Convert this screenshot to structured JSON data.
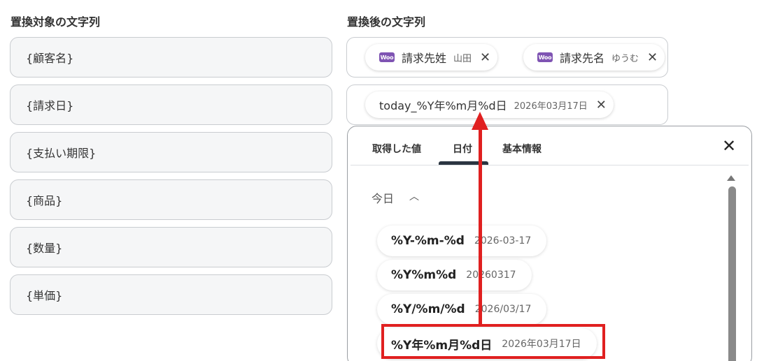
{
  "left": {
    "title": "置換対象の文字列",
    "fields": [
      "{顧客名}",
      "{請求日}",
      "{支払い期限}",
      "{商品}",
      "{数量}",
      "{単価}"
    ]
  },
  "right": {
    "title": "置換後の文字列",
    "row1_chips": [
      {
        "icon": "woo",
        "name": "請求先姓",
        "value": "山田"
      },
      {
        "icon": "woo",
        "name": "請求先名",
        "value": "ゆうむ"
      }
    ],
    "row2_chip": {
      "name": "today_%Y年%m月%d日",
      "value": "2026年03月17日"
    }
  },
  "panel": {
    "tabs": [
      "取得した値",
      "日付",
      "基本情報"
    ],
    "active_tab": "日付",
    "section_label": "今日",
    "options": [
      {
        "name": "%Y-%m-%d",
        "value": "2026-03-17"
      },
      {
        "name": "%Y%m%d",
        "value": "20260317"
      },
      {
        "name": "%Y/%m/%d",
        "value": "2026/03/17"
      },
      {
        "name": "%Y年%m月%d日",
        "value": "2026年03月17日"
      }
    ]
  },
  "annotation": {
    "color": "#e02020"
  },
  "icons": {
    "chip_close": "close-icon",
    "panel_close": "close-icon",
    "section_toggle": "chevron-up-icon",
    "woo": "woocommerce-icon"
  }
}
